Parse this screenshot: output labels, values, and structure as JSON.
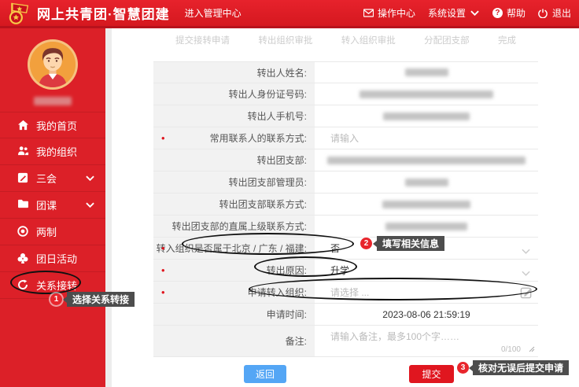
{
  "header": {
    "title": "网上共青团·智慧团建",
    "subtitle": "进入管理中心",
    "nav": [
      {
        "label": "操作中心",
        "icon": "mail-icon"
      },
      {
        "label": "系统设置",
        "icon": "chevron-down-icon"
      },
      {
        "label": "帮助",
        "icon": "question-icon",
        "glyph": "?"
      },
      {
        "label": "退出",
        "icon": "power-icon"
      }
    ]
  },
  "sidebar": {
    "items": [
      {
        "label": "我的首页",
        "icon": "home-icon"
      },
      {
        "label": "我的组织",
        "icon": "people-icon"
      },
      {
        "label": "三会",
        "icon": "document-icon",
        "expandable": true
      },
      {
        "label": "团课",
        "icon": "folder-icon",
        "expandable": true
      },
      {
        "label": "两制",
        "icon": "target-icon"
      },
      {
        "label": "团日活动",
        "icon": "club-icon"
      },
      {
        "label": "关系接转",
        "icon": "refresh-icon"
      }
    ]
  },
  "steps": [
    "提交接转申请",
    "转出组织审批",
    "转入组织审批",
    "分配团支部",
    "完成"
  ],
  "form": {
    "rows": [
      {
        "label": "转出人姓名:",
        "type": "redacted"
      },
      {
        "label": "转出人身份证号码:",
        "type": "redacted"
      },
      {
        "label": "转出人手机号:",
        "type": "redacted"
      },
      {
        "label": "常用联系人的联系方式:",
        "type": "input",
        "required": true,
        "placeholder": "请输入"
      },
      {
        "label": "转出团支部:",
        "type": "redacted"
      },
      {
        "label": "转出团支部管理员:",
        "type": "redacted"
      },
      {
        "label": "转出团支部联系方式:",
        "type": "redacted"
      },
      {
        "label": "转出团支部的直属上级联系方式:",
        "type": "redacted"
      },
      {
        "label": "转入组织是否属于北京 / 广东 / 福建:",
        "type": "select",
        "required": true,
        "value": "否"
      },
      {
        "label": "转出原因:",
        "type": "select",
        "required": true,
        "value": "升学"
      },
      {
        "label": "申请转入组织:",
        "type": "picker",
        "required": true,
        "placeholder": "请选择 ..."
      },
      {
        "label": "申请时间:",
        "type": "text",
        "value": "2023-08-06 21:59:19"
      },
      {
        "label": "备注:",
        "type": "textarea",
        "placeholder": "请输入备注，最多100个字……",
        "counter": "0/100"
      }
    ]
  },
  "buttons": {
    "back": "返回",
    "submit": "提交"
  },
  "annotations": [
    {
      "num": "1",
      "tip": "选择关系转接"
    },
    {
      "num": "2",
      "tip": "填写相关信息"
    },
    {
      "num": "3",
      "tip": "核对无误后提交申请"
    }
  ],
  "colors": {
    "header_red": "#e1212b",
    "sidebar_red": "#dc2028",
    "accent_blue": "#54a6f5",
    "submit_red": "#e0161f",
    "badge_red": "#e8252c",
    "tooltip_bg": "#4d4d4d"
  }
}
